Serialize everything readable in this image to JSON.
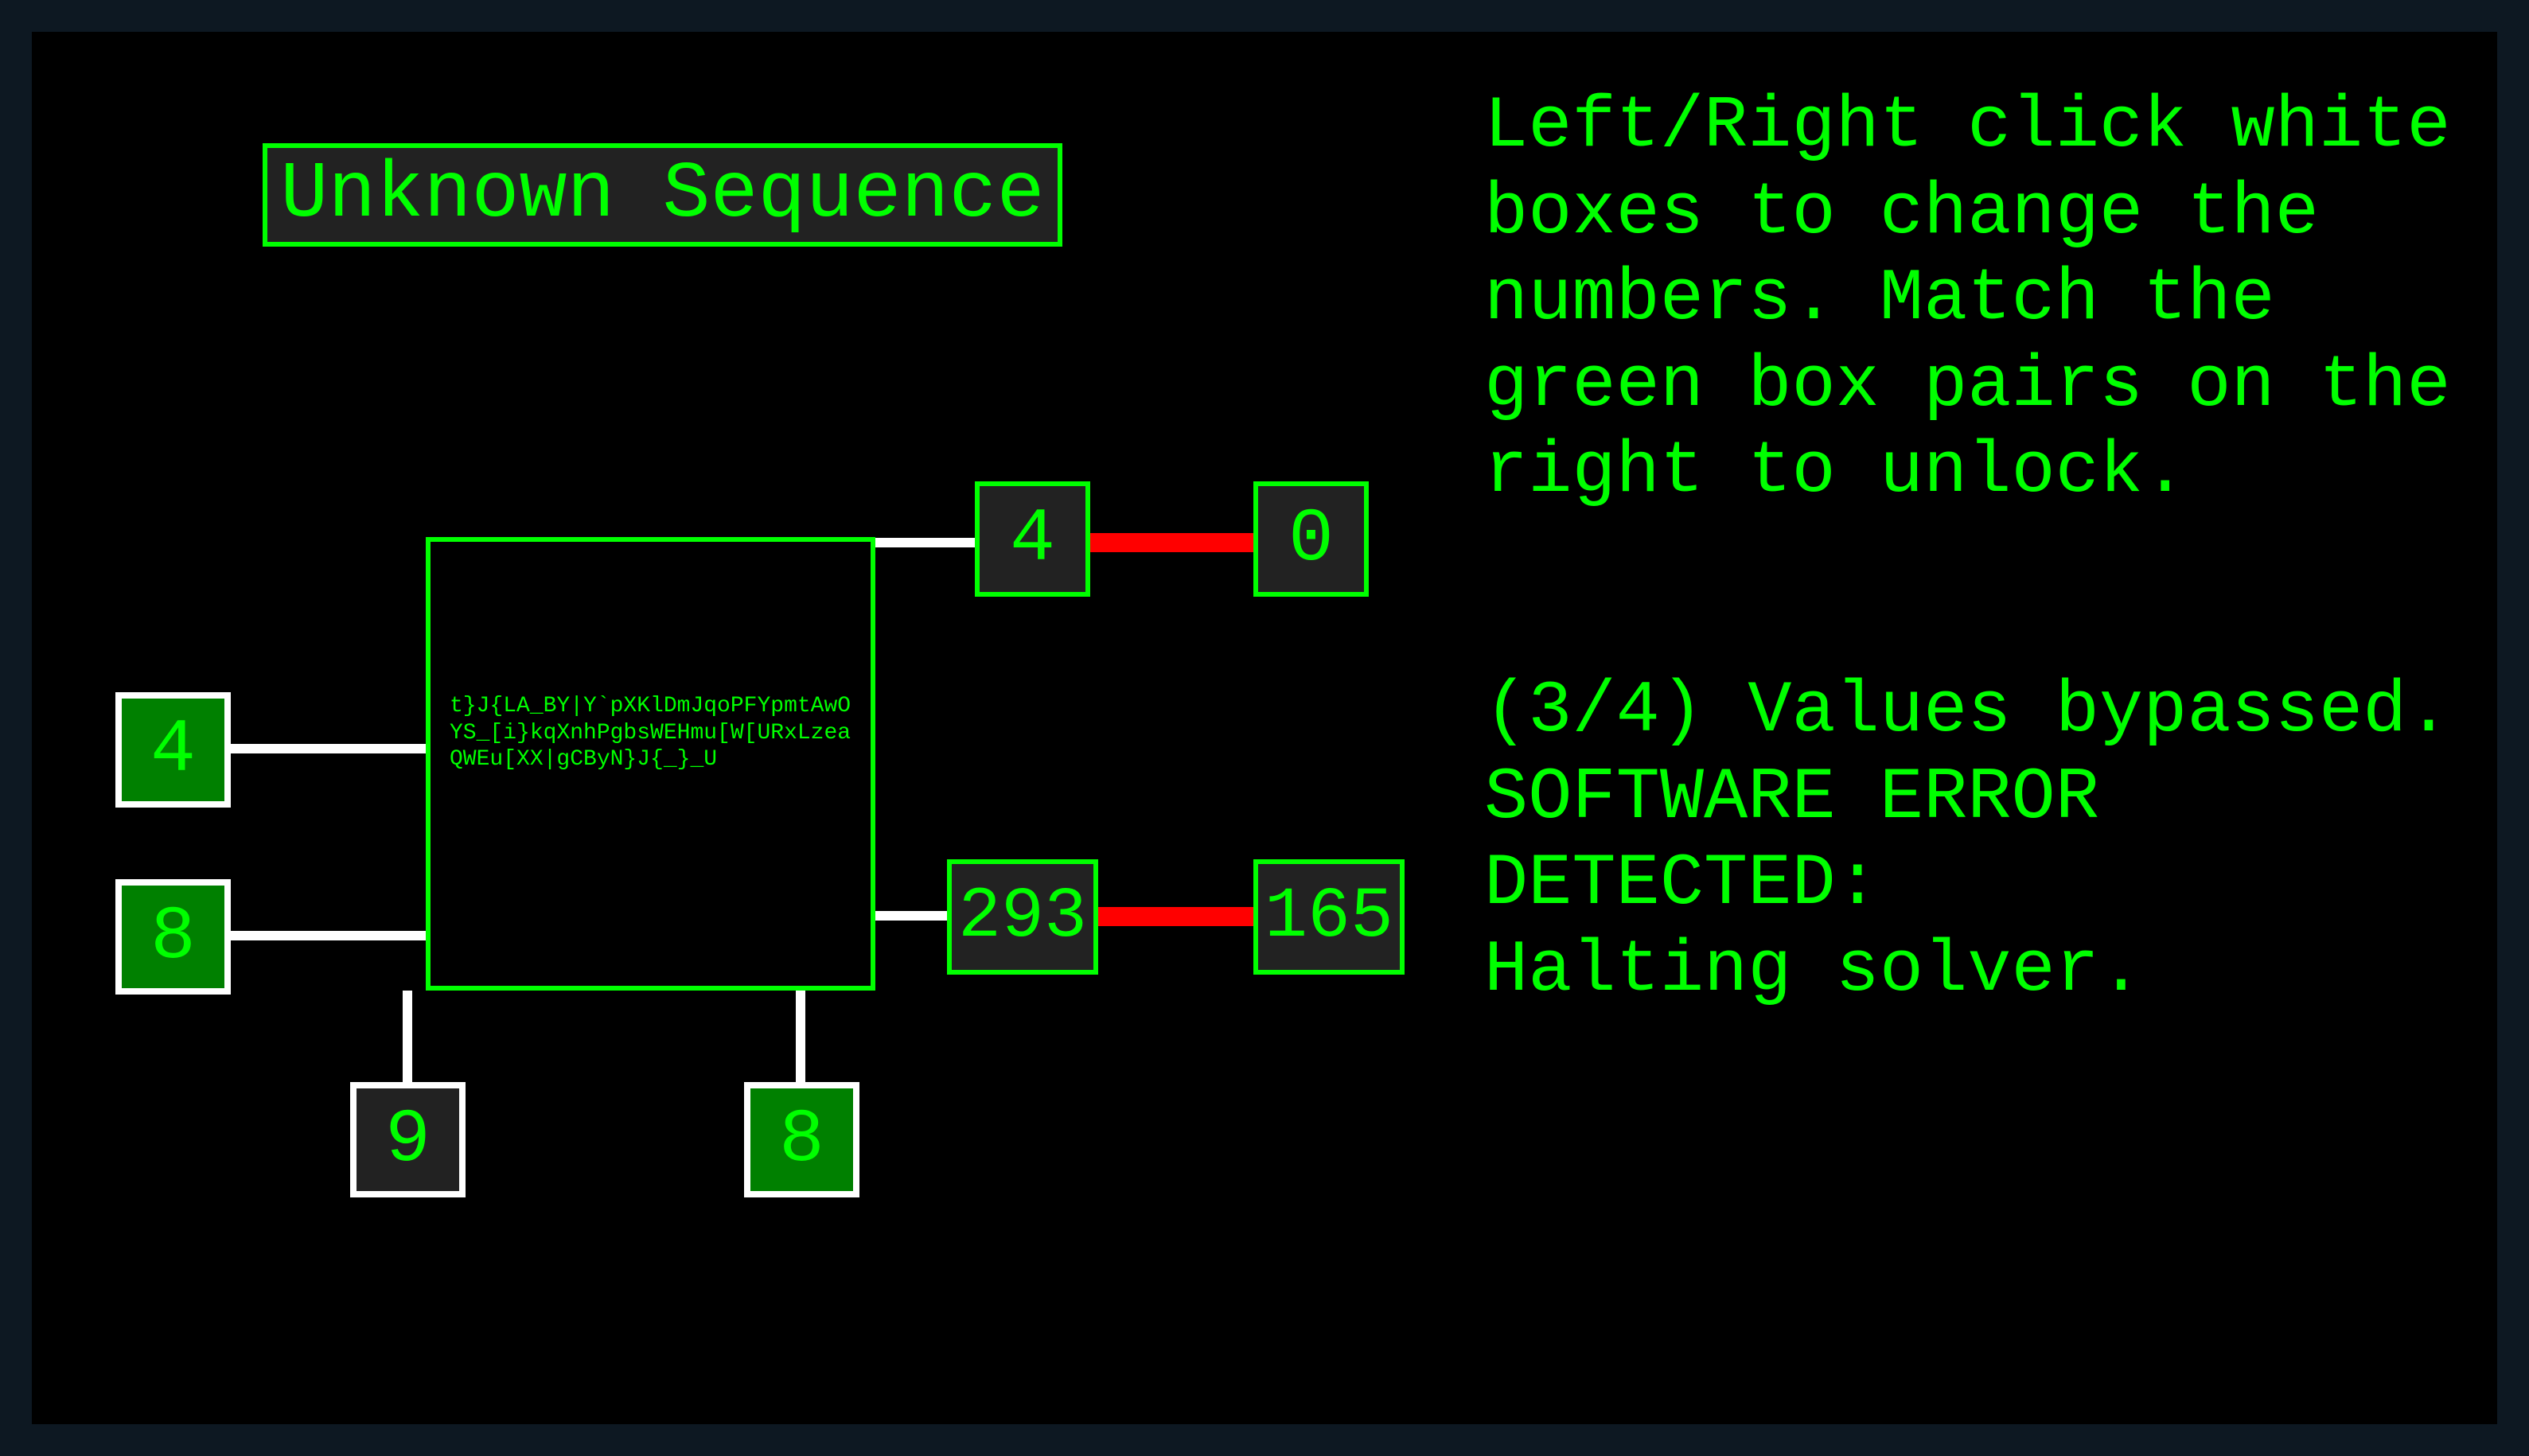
{
  "title": "Unknown Sequence",
  "central_text": "t}J{LA_BY|Y`pXKlDmJqoPFYpmtAwOYS_[i}kqXnhPgbsWEHmu[W[URxLzeaQWEu[XX|gCByN}J{_}_U",
  "inputs": {
    "left_top": "4",
    "left_bottom": "8",
    "bottom_left": "9",
    "bottom_right": "8"
  },
  "outputs": {
    "top_out": "4",
    "top_target": "0",
    "bottom_out": "293",
    "bottom_target": "165"
  },
  "instructions": "Left/Right click white boxes to change the numbers. Match the green box pairs on the right to unlock.",
  "status": "(3/4) Values bypassed.\nSOFTWARE ERROR DETECTED:\nHalting solver.",
  "colors": {
    "green": "#00ff00",
    "bg": "#000000",
    "dark_box": "#222222",
    "fill_green": "#008000",
    "red": "#ff0000",
    "white": "#ffffff"
  }
}
